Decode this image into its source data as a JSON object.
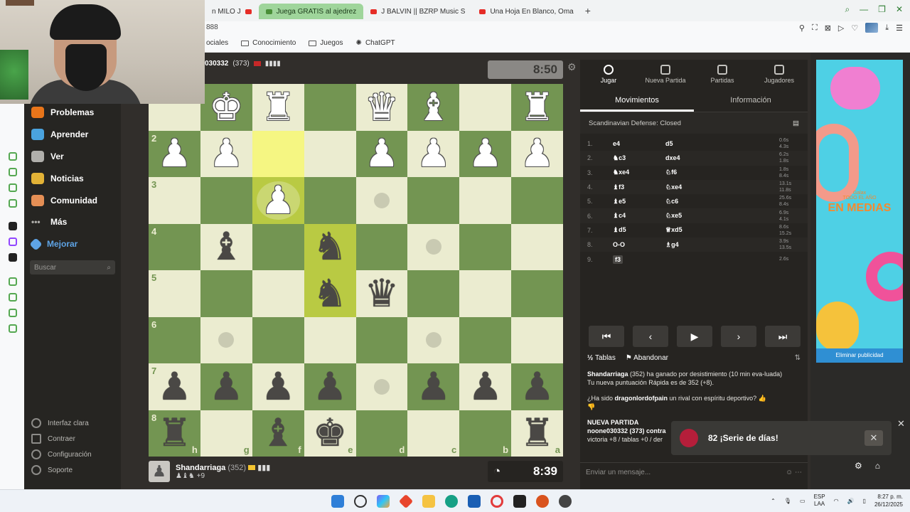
{
  "browser": {
    "tabs": [
      {
        "label": "n MILO J",
        "active": false
      },
      {
        "label": "Juega GRATIS al ajedrez",
        "active": true
      },
      {
        "label": "J BALVIN || BZRP Music S",
        "active": false
      },
      {
        "label": "Una Hoja En Blanco, Oma",
        "active": false
      }
    ],
    "url_fragment": "888",
    "bookmarks": [
      "ociales",
      "Conocimiento",
      "Juegos",
      "ChatGPT"
    ]
  },
  "sidebar": {
    "items": [
      {
        "label": "Problemas",
        "color": "#e8751a"
      },
      {
        "label": "Aprender",
        "color": "#4aa3df"
      },
      {
        "label": "Ver",
        "color": "#b0afab"
      },
      {
        "label": "Noticias",
        "color": "#e2b236"
      },
      {
        "label": "Comunidad",
        "color": "#e58f55"
      },
      {
        "label": "Más",
        "color": "#b0afab"
      },
      {
        "label": "Mejorar",
        "color": "#5ea4e6"
      }
    ],
    "search_placeholder": "Buscar",
    "bottom": [
      "Interfaz clara",
      "Contraer",
      "Configuración",
      "Soporte"
    ]
  },
  "opponent": {
    "name": "030332",
    "rating": "(373)"
  },
  "player": {
    "name": "Shandarriaga",
    "rating": "(352)",
    "material": "+9"
  },
  "clocks": {
    "top": "8:50",
    "bottom": "8:39"
  },
  "board": {
    "ranks": [
      "",
      "2",
      "3",
      "4",
      "5",
      "6",
      "7",
      "8"
    ],
    "files": [
      "h",
      "g",
      "f",
      "e",
      "d",
      "c",
      "b",
      "a"
    ],
    "pieces": [
      [
        "",
        "w:♚",
        "w:♜",
        "",
        "w:♛",
        "w:♝",
        "",
        "w:♜"
      ],
      [
        "w:♟",
        "w:♟",
        "",
        "",
        "w:♟",
        "w:♟",
        "w:♟",
        "w:♟"
      ],
      [
        "",
        "",
        "w:♟",
        "",
        "",
        "",
        "",
        ""
      ],
      [
        "",
        "b:♝",
        "",
        "b:♞",
        "",
        "",
        "",
        ""
      ],
      [
        "",
        "",
        "",
        "b:♞",
        "b:♛",
        "",
        "",
        ""
      ],
      [
        "",
        "",
        "",
        "",
        "",
        "",
        "",
        ""
      ],
      [
        "b:♟",
        "b:♟",
        "b:♟",
        "b:♟",
        "",
        "b:♟",
        "b:♟",
        "b:♟"
      ],
      [
        "b:♜",
        "",
        "b:♝",
        "b:♚",
        "",
        "",
        "",
        "b:♜"
      ]
    ]
  },
  "panel": {
    "tabs": [
      {
        "label": "Jugar",
        "active": true
      },
      {
        "label": "Nueva Partida",
        "active": false
      },
      {
        "label": "Partidas",
        "active": false
      },
      {
        "label": "Jugadores",
        "active": false
      }
    ],
    "subtabs": [
      "Movimientos",
      "Información"
    ],
    "opening": "Scandinavian Defense: Closed",
    "moves": [
      {
        "n": "1.",
        "w": "e4",
        "b": "d5",
        "t1": "0.6s",
        "t2": "4.3s"
      },
      {
        "n": "2.",
        "w": "♞c3",
        "b": "dxe4",
        "t1": "6.2s",
        "t2": "1.8s"
      },
      {
        "n": "3.",
        "w": "♞xe4",
        "b": "♘f6",
        "t1": "1.8s",
        "t2": "8.4s"
      },
      {
        "n": "4.",
        "w": "♝f3",
        "b": "♘xe4",
        "t1": "13.1s",
        "t2": "11.8s"
      },
      {
        "n": "5.",
        "w": "♝e5",
        "b": "♘c6",
        "t1": "25.6s",
        "t2": "8.4s"
      },
      {
        "n": "6.",
        "w": "♝c4",
        "b": "♘xe5",
        "t1": "6.9s",
        "t2": "4.1s"
      },
      {
        "n": "7.",
        "w": "♝d5",
        "b": "♕xd5",
        "t1": "8.6s",
        "t2": "15.2s"
      },
      {
        "n": "8.",
        "w": "O-O",
        "b": "♗g4",
        "t1": "3.9s",
        "t2": "13.5s"
      },
      {
        "n": "9.",
        "w": "f3",
        "b": "",
        "t1": "2.6s",
        "t2": ""
      }
    ],
    "draw_label": "Tablas",
    "resign_label": "Abandonar",
    "chat": {
      "line1_name": "Shandarriaga",
      "line1_rest": "(352) ha ganado por desistimiento (10 min eva-luada)",
      "line2": "Tu nueva puntuación Rápida es de 352 (+8).",
      "line3_pre": "¿Ha sido",
      "line3_name": "dragonlordofpain",
      "line3_post": "un rival con espíritu deportivo?",
      "new_game": "NUEVA PARTIDA",
      "new_game_line": "noone030332 (373) contra",
      "new_game_line2": "victoria +8 / tablas +0 / der",
      "input_placeholder": "Enviar un mensaje..."
    }
  },
  "toast": {
    "text": "82 ¡Serie de días!"
  },
  "ad": {
    "brand": "Galax",
    "tagline": "TODO EL AÑO",
    "headline": "EN MEDIAS",
    "remove": "Eliminar publicidad"
  },
  "taskbar": {
    "lang": "ESP",
    "lang2": "LAA",
    "time": "8:27 p. m.",
    "date": "26/12/2025"
  }
}
